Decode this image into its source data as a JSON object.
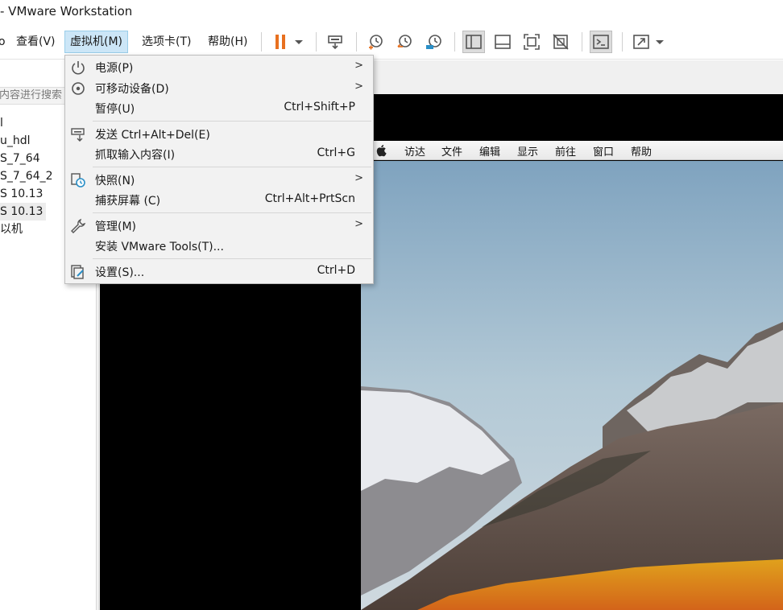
{
  "window": {
    "title": "- VMware Workstation"
  },
  "menubar": {
    "items": [
      {
        "label": "o"
      },
      {
        "label": "查看(V)"
      },
      {
        "label": "虚拟机(M)",
        "active": true
      },
      {
        "label": "选项卡(T)"
      },
      {
        "label": "帮助(H)"
      }
    ]
  },
  "toolbar": {
    "icons": [
      "pause-icon",
      "dropdown-arrow-icon",
      "send-ctrl-alt-del-icon",
      "snapshot-take-icon",
      "snapshot-revert-icon",
      "snapshot-manager-icon",
      "show-library-icon",
      "show-thumbnail-bar-icon",
      "fit-guest-icon",
      "unity-disabled-icon",
      "console-icon",
      "fullscreen-icon"
    ],
    "accent": "#e8701f"
  },
  "library": {
    "search_placeholder": "内容进行搜索",
    "items": [
      "l",
      "u_hdl",
      "S_7_64",
      "S_7_64_2",
      "S 10.13",
      "S 10.13",
      "以机"
    ]
  },
  "vm_menu": {
    "items": [
      {
        "label": "电源(P)",
        "shortcut": "",
        "submenu": true,
        "icon": "power-icon"
      },
      {
        "label": "可移动设备(D)",
        "shortcut": "",
        "submenu": true,
        "icon": "removable-device-icon"
      },
      {
        "label": "暂停(U)",
        "shortcut": "Ctrl+Shift+P",
        "submenu": false,
        "icon": ""
      },
      {
        "label": "发送 Ctrl+Alt+Del(E)",
        "shortcut": "",
        "submenu": false,
        "icon": "send-keys-icon"
      },
      {
        "label": "抓取输入内容(I)",
        "shortcut": "Ctrl+G",
        "submenu": false,
        "icon": ""
      },
      {
        "label": "快照(N)",
        "shortcut": "",
        "submenu": true,
        "icon": "snapshot-icon"
      },
      {
        "label": "捕获屏幕 (C)",
        "shortcut": "Ctrl+Alt+PrtScn",
        "submenu": false,
        "icon": ""
      },
      {
        "label": "管理(M)",
        "shortcut": "",
        "submenu": true,
        "icon": "wrench-icon"
      },
      {
        "label": "安装 VMware Tools(T)...",
        "shortcut": "",
        "submenu": false,
        "icon": ""
      },
      {
        "label": "设置(S)...",
        "shortcut": "Ctrl+D",
        "submenu": false,
        "icon": "settings-icon"
      }
    ],
    "submenu_arrow": ">"
  },
  "guest": {
    "mac_menubar": [
      "访达",
      "文件",
      "编辑",
      "显示",
      "前往",
      "窗口",
      "帮助"
    ]
  }
}
